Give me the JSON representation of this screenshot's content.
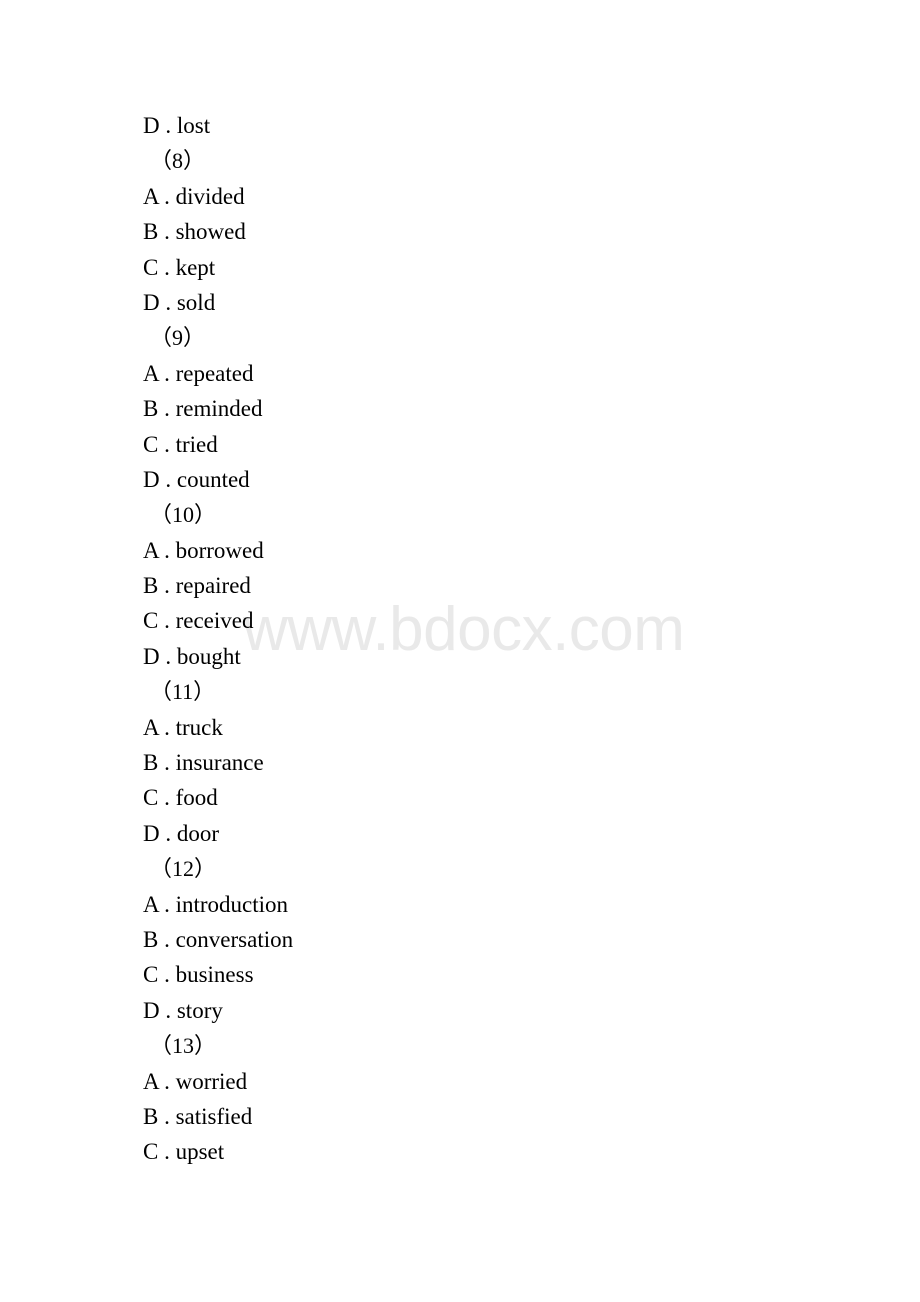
{
  "document": {
    "type": "exam-worksheet-page",
    "watermark": "www.bdocx.com",
    "watermark_color": "#e9e9e9",
    "text_color": "#000000",
    "background_color": "#ffffff"
  },
  "lines": [
    {
      "kind": "option",
      "text": "D . lost"
    },
    {
      "kind": "question",
      "text": "（8）"
    },
    {
      "kind": "option",
      "text": "A . divided"
    },
    {
      "kind": "option",
      "text": "B . showed"
    },
    {
      "kind": "option",
      "text": "C . kept"
    },
    {
      "kind": "option",
      "text": "D . sold"
    },
    {
      "kind": "question",
      "text": "（9）"
    },
    {
      "kind": "option",
      "text": "A . repeated"
    },
    {
      "kind": "option",
      "text": "B . reminded"
    },
    {
      "kind": "option",
      "text": "C . tried"
    },
    {
      "kind": "option",
      "text": "D . counted"
    },
    {
      "kind": "question",
      "text": "（10）"
    },
    {
      "kind": "option",
      "text": "A . borrowed"
    },
    {
      "kind": "option",
      "text": "B . repaired"
    },
    {
      "kind": "option",
      "text": "C . received"
    },
    {
      "kind": "option",
      "text": "D . bought"
    },
    {
      "kind": "question",
      "text": "（11）"
    },
    {
      "kind": "option",
      "text": "A . truck"
    },
    {
      "kind": "option",
      "text": "B . insurance"
    },
    {
      "kind": "option",
      "text": "C . food"
    },
    {
      "kind": "option",
      "text": "D . door"
    },
    {
      "kind": "question",
      "text": "（12）"
    },
    {
      "kind": "option",
      "text": "A . introduction"
    },
    {
      "kind": "option",
      "text": "B . conversation"
    },
    {
      "kind": "option",
      "text": "C . business"
    },
    {
      "kind": "option",
      "text": "D . story"
    },
    {
      "kind": "question",
      "text": "（13）"
    },
    {
      "kind": "option",
      "text": "A . worried"
    },
    {
      "kind": "option",
      "text": "B . satisfied"
    },
    {
      "kind": "option",
      "text": "C . upset"
    }
  ],
  "questions": [
    {
      "number": "8",
      "label": "（8）",
      "options": [
        "A . divided",
        "B . showed",
        "C . kept",
        "D . sold"
      ]
    },
    {
      "number": "9",
      "label": "（9）",
      "options": [
        "A . repeated",
        "B . reminded",
        "C . tried",
        "D . counted"
      ]
    },
    {
      "number": "10",
      "label": "（10）",
      "options": [
        "A . borrowed",
        "B . repaired",
        "C . received",
        "D . bought"
      ]
    },
    {
      "number": "11",
      "label": "（11）",
      "options": [
        "A . truck",
        "B . insurance",
        "C . food",
        "D . door"
      ]
    },
    {
      "number": "12",
      "label": "（12）",
      "options": [
        "A . introduction",
        "B . conversation",
        "C . business",
        "D . story"
      ]
    },
    {
      "number": "13",
      "label": "（13）",
      "options": [
        "A . worried",
        "B . satisfied",
        "C . upset"
      ]
    }
  ]
}
